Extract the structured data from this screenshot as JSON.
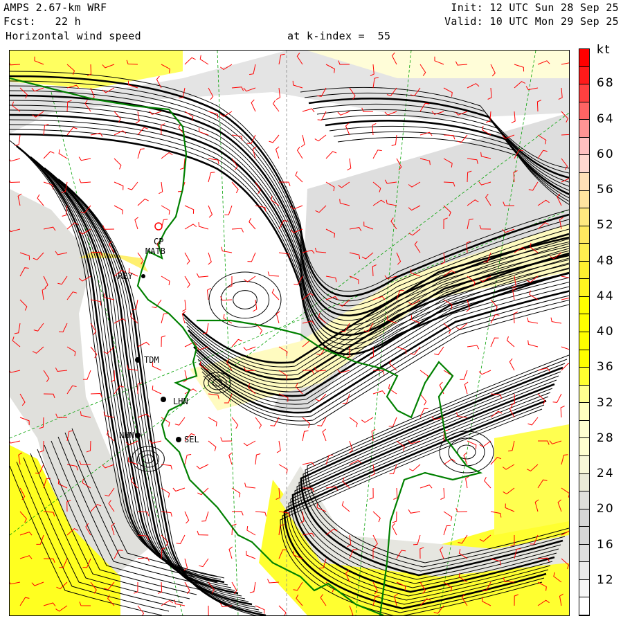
{
  "header": {
    "model": "AMPS 2.67-km WRF",
    "forecast": "Fcst:   22 h",
    "field": "Horizontal wind speed",
    "level": "at k-index =  55",
    "init": "Init: 12 UTC Sun 28 Sep 25",
    "valid": "Valid: 10 UTC Mon 29 Sep 25"
  },
  "colorbar": {
    "unit": "kt",
    "labels": [
      "68",
      "64",
      "60",
      "56",
      "52",
      "48",
      "44",
      "40",
      "36",
      "32",
      "28",
      "24",
      "20",
      "16",
      "12"
    ],
    "range": [
      8,
      72
    ],
    "step": 2,
    "colors_top_to_bottom": [
      "#ff0000",
      "#ff1a1a",
      "#ff4040",
      "#ff6464",
      "#ff9494",
      "#ffc0c0",
      "#ffd8d0",
      "#ffe0b8",
      "#ffe4a0",
      "#ffe880",
      "#ffe860",
      "#ffee50",
      "#fff030",
      "#fff520",
      "#ffff00",
      "#ffff00",
      "#ffff00",
      "#ffff00",
      "#ffff30",
      "#ffff90",
      "#ffffc0",
      "#ffffd0",
      "#ffffd0",
      "#f8f8d8",
      "#ebebd8",
      "#e0e0dc",
      "#d6d6d6",
      "#d6d6d6",
      "#dedede",
      "#ebebeb",
      "#f6f6f6",
      "#ffffff"
    ]
  },
  "stations": [
    {
      "id": "CP"
    },
    {
      "id": "MATB"
    },
    {
      "id": "REY"
    },
    {
      "id": "TDM"
    },
    {
      "id": "LHN"
    },
    {
      "id": "NHN"
    },
    {
      "id": "SEL"
    }
  ],
  "colors": {
    "streamline": "#000000",
    "wind_barb": "#ff0000",
    "coastline": "#008000",
    "grid": "#00a000"
  }
}
